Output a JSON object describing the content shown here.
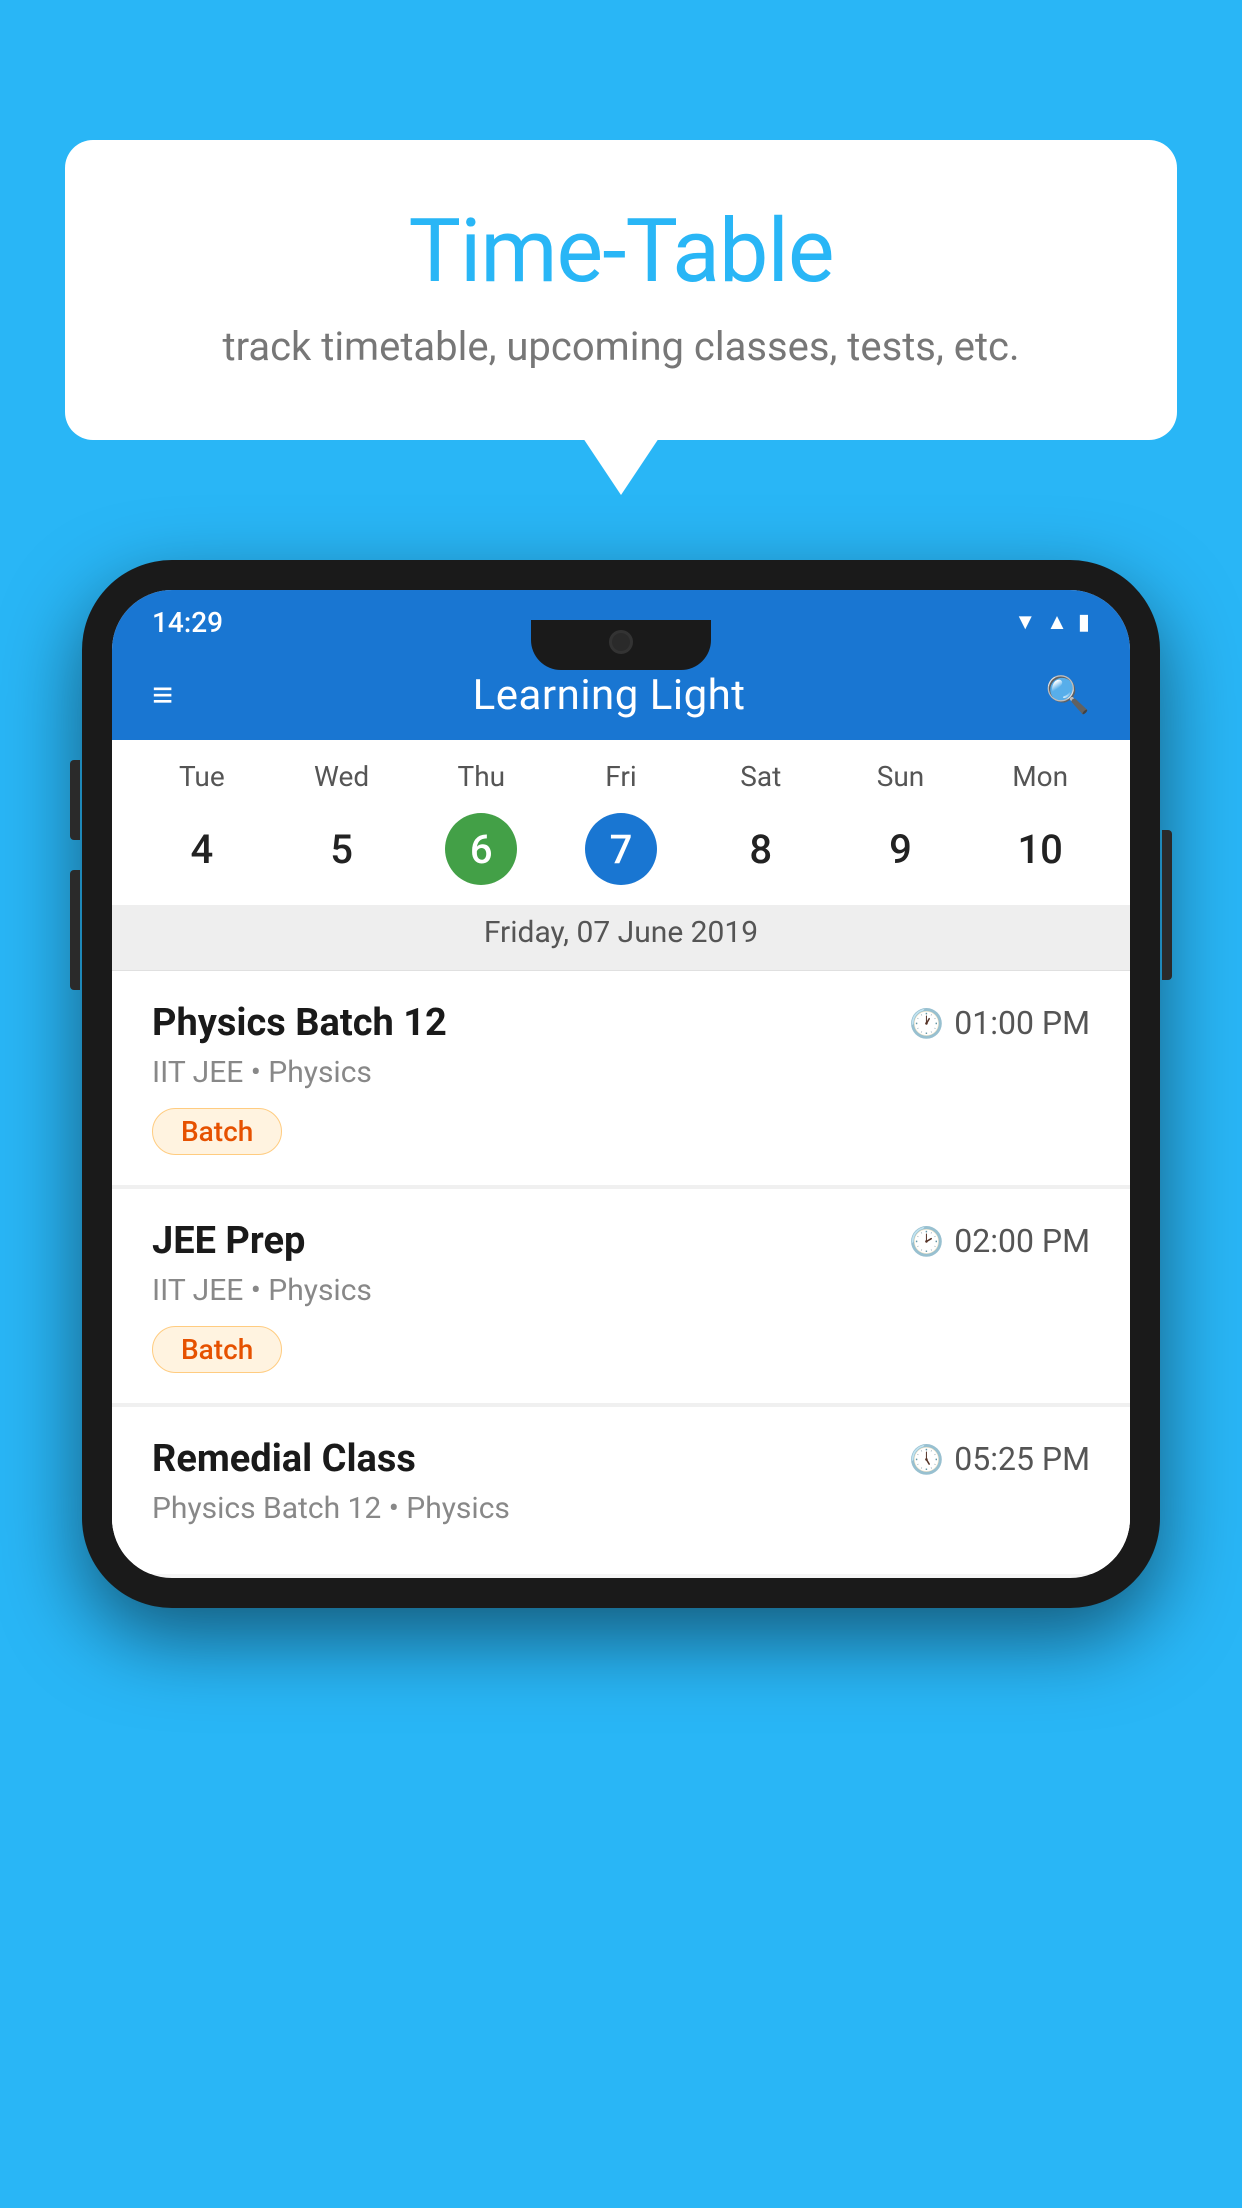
{
  "background_color": "#29B6F6",
  "speech_bubble": {
    "title": "Time-Table",
    "subtitle": "track timetable, upcoming classes, tests, etc."
  },
  "phone": {
    "status_bar": {
      "time": "14:29",
      "icons": [
        "wifi",
        "signal",
        "battery"
      ]
    },
    "app_header": {
      "title": "Learning Light",
      "menu_icon": "≡",
      "search_icon": "🔍"
    },
    "calendar": {
      "days": [
        {
          "label": "Tue",
          "number": "4"
        },
        {
          "label": "Wed",
          "number": "5"
        },
        {
          "label": "Thu",
          "number": "6",
          "state": "today"
        },
        {
          "label": "Fri",
          "number": "7",
          "state": "selected"
        },
        {
          "label": "Sat",
          "number": "8"
        },
        {
          "label": "Sun",
          "number": "9"
        },
        {
          "label": "Mon",
          "number": "10"
        }
      ],
      "selected_date": "Friday, 07 June 2019"
    },
    "schedule": [
      {
        "title": "Physics Batch 12",
        "time": "01:00 PM",
        "subject": "IIT JEE • Physics",
        "badge": "Batch"
      },
      {
        "title": "JEE Prep",
        "time": "02:00 PM",
        "subject": "IIT JEE • Physics",
        "badge": "Batch"
      },
      {
        "title": "Remedial Class",
        "time": "05:25 PM",
        "subject": "Physics Batch 12 • Physics",
        "badge": null
      }
    ]
  }
}
